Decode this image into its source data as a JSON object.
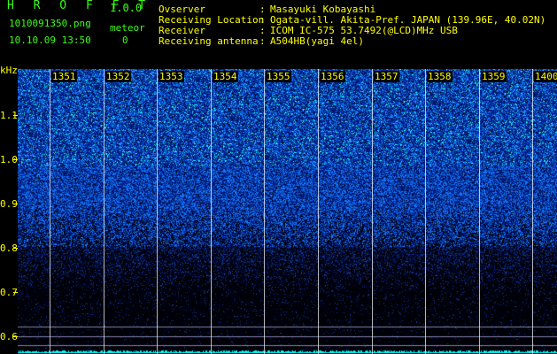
{
  "header": {
    "app_name": "H R O F F T",
    "version": "1.0.0",
    "filename": "1010091350.png",
    "meteor_label": "meteor",
    "meteor_count": "0",
    "datetime": "10.10.09 13:50"
  },
  "info": {
    "observer_label": "Ovserver",
    "observer_value": "Masayuki Kobayashi",
    "location_label": "Receiving Location",
    "location_value": "Ogata-vill. Akita-Pref. JAPAN (139.96E, 40.02N)",
    "receiver_label": "Receiver",
    "receiver_value": "ICOM IC-575 53.7492(@LCD)MHz USB",
    "antenna_label": "Receiving antenna",
    "antenna_value": "A504HB(yagi 4el)",
    "separator": ":"
  },
  "y_axis": {
    "unit": "kHz",
    "labels": [
      "1.1",
      "1.0",
      "0.9",
      "0.8",
      "0.7",
      "0.6"
    ]
  },
  "time_labels": [
    "1351",
    "1352",
    "1353",
    "1354",
    "1355",
    "1356",
    "1357",
    "1358",
    "1359",
    "1400"
  ],
  "colors": {
    "header_green": "#39ff14",
    "header_yellow": "#ffff00",
    "noise_blue": "#1a3cff",
    "noise_cyan": "#3cd8ff",
    "baseline_cyan": "#00ffff"
  }
}
